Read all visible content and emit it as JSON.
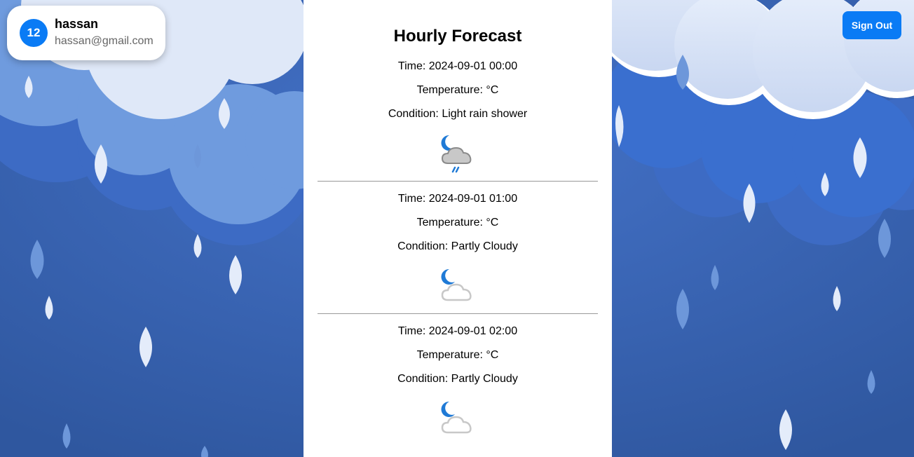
{
  "user": {
    "avatar_text": "12",
    "name": "hassan",
    "email": "hassan@gmail.com"
  },
  "header": {
    "signout_label": "Sign Out"
  },
  "forecast": {
    "title": "Hourly Forecast",
    "entries": [
      {
        "time": "Time: 2024-09-01 00:00",
        "temperature": "Temperature: °C",
        "condition": "Condition: Light rain shower",
        "icon": "night-rain-shower-icon"
      },
      {
        "time": "Time: 2024-09-01 01:00",
        "temperature": "Temperature: °C",
        "condition": "Condition: Partly Cloudy",
        "icon": "night-partly-cloudy-icon"
      },
      {
        "time": "Time: 2024-09-01 02:00",
        "temperature": "Temperature: °C",
        "condition": "Condition: Partly Cloudy",
        "icon": "night-partly-cloudy-icon"
      }
    ]
  },
  "colors": {
    "accent": "#0a7bf5",
    "background": "#3a63b8",
    "panel": "#ffffff"
  }
}
